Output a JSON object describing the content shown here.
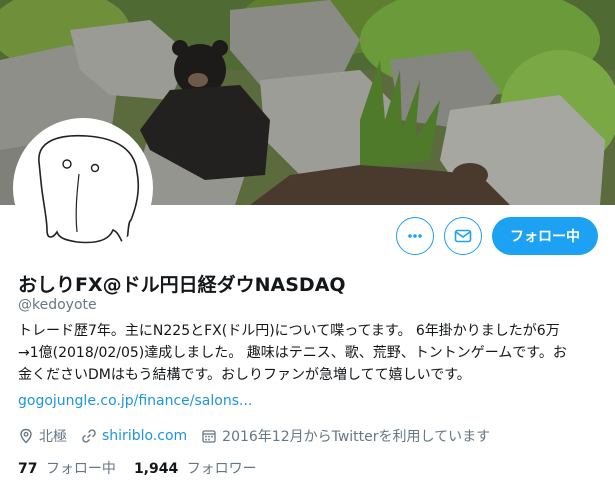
{
  "profile": {
    "name": "おしりFX@ドル円日経ダウNASDAQ",
    "handle": "@kedoyote",
    "bio_lines": [
      "トレード歴7年。主にN225とFX(ドル円)について喋ってます。 6年掛かりましたが6万",
      "→1億(2018/02/05)達成しました。 趣味はテニス、歌、荒野、トントンゲームです。お",
      "金くださいDMはもう結構です。おしりファンが急増してて嬉しいです。"
    ],
    "link": "gogojungle.co.jp/finance/salons...",
    "location": "北極",
    "website": "shiriblo.com",
    "joined": "2016年12月からTwitterを利用しています"
  },
  "actions": {
    "more_icon": "more-icon",
    "message_icon": "envelope-icon",
    "follow_label": "フォロー中"
  },
  "stats": {
    "following_count": "77",
    "following_label": "フォロー中",
    "followers_count": "1,944",
    "followers_label": "フォロワー"
  },
  "colors": {
    "accent": "#1da1f2",
    "link": "#1b95e0",
    "secondary_text": "#657786"
  }
}
